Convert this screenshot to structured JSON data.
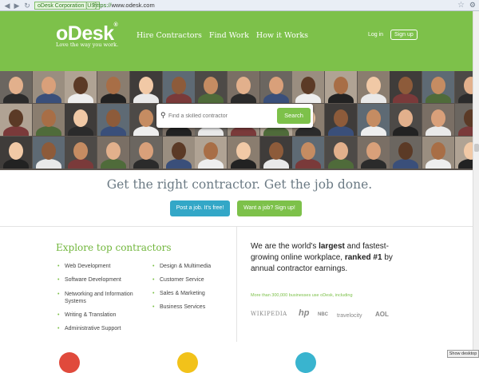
{
  "browser": {
    "site_identity": "oDesk Corporation [US]",
    "url_protocol": "https://",
    "url_host": "www.odesk.com"
  },
  "header": {
    "logo": "oDesk",
    "tagline": "Love the way you work.",
    "nav": [
      "Hire Contractors",
      "Find Work",
      "How it Works"
    ],
    "login": "Log in",
    "signup": "Sign up",
    "bg_color": "#7dc14a"
  },
  "search": {
    "placeholder": "Find a skilled contractor",
    "button": "Search"
  },
  "hero": {
    "headline": "Get the right contractor. Get the job done.",
    "post_job": "Post a job. It's free!",
    "want_job": "Want a job? Sign up!"
  },
  "explore": {
    "title": "Explore top contractors",
    "left_col": [
      "Web Development",
      "Software Development",
      "Networking and Information Systems",
      "Writing & Translation",
      "Administrative Support"
    ],
    "right_col": [
      "Design & Multimedia",
      "Customer Service",
      "Sales & Marketing",
      "Business Services"
    ]
  },
  "about": {
    "line1_pre": "We are the world's ",
    "line1_bold": "largest",
    "line1_post": " and fastest-growing online workplace, ",
    "line2_bold": "ranked #1",
    "line2_post": " by annual contractor earnings.",
    "more": "More than 300,000 businesses use oDesk, including"
  },
  "clients": [
    "WIKIPEDIA",
    "hp",
    "NBC",
    "travelocity",
    "AOL"
  ],
  "taskbar": {
    "show_desktop": "Show desktop"
  }
}
